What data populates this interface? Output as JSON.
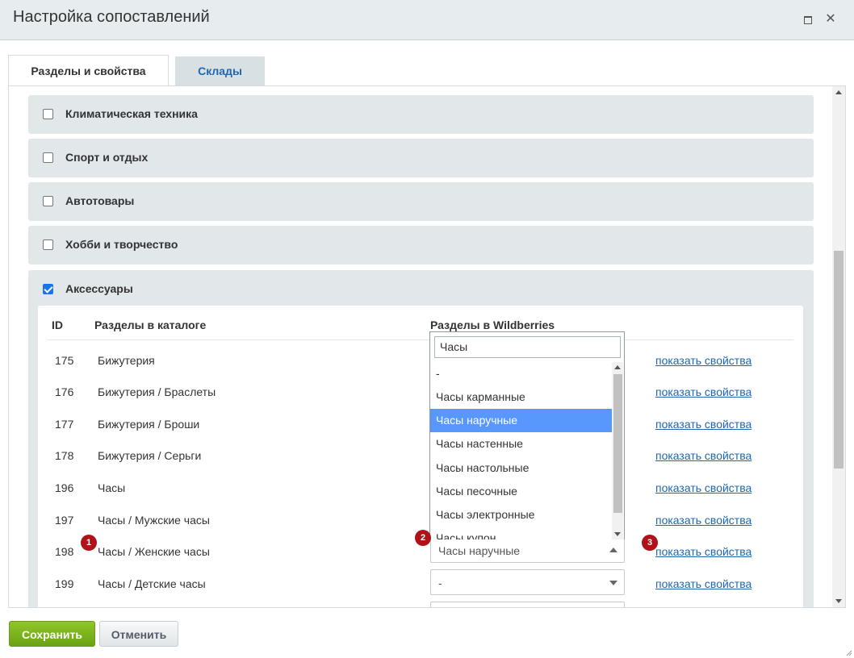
{
  "window": {
    "title": "Настройка сопоставлений"
  },
  "tabs": [
    {
      "label": "Разделы и свойства",
      "active": true
    },
    {
      "label": "Склады",
      "active": false
    }
  ],
  "categories": [
    {
      "label": "Климатическая техника",
      "checked": false
    },
    {
      "label": "Спорт и отдых",
      "checked": false
    },
    {
      "label": "Автотовары",
      "checked": false
    },
    {
      "label": "Хобби и творчество",
      "checked": false
    }
  ],
  "open_category": {
    "label": "Аксессуары",
    "checked": true
  },
  "table": {
    "headers": {
      "id": "ID",
      "catalog": "Разделы в каталоге",
      "wb": "Разделы в Wildberries"
    },
    "rows": [
      {
        "id": "175",
        "name": "Бижутерия",
        "link": "показать свойства"
      },
      {
        "id": "176",
        "name": "Бижутерия / Браслеты",
        "link": "показать свойства"
      },
      {
        "id": "177",
        "name": "Бижутерия / Броши",
        "link": "показать свойства"
      },
      {
        "id": "178",
        "name": "Бижутерия / Серьги",
        "link": "показать свойства"
      },
      {
        "id": "196",
        "name": "Часы",
        "link": "показать свойства"
      },
      {
        "id": "197",
        "name": "Часы / Мужские часы",
        "link": "показать свойства"
      },
      {
        "id": "198",
        "name": "Часы / Женские часы",
        "link": "показать свойства",
        "select": "Часы наручные"
      },
      {
        "id": "199",
        "name": "Часы / Детские часы",
        "link": "показать свойства",
        "select": "-"
      }
    ]
  },
  "dropdown": {
    "search_value": "Часы",
    "options": [
      "-",
      "Часы карманные",
      "Часы наручные",
      "Часы настенные",
      "Часы настольные",
      "Часы песочные",
      "Часы электронные",
      "Часы купон"
    ],
    "selected": "Часы наручные"
  },
  "badges": [
    "1",
    "2",
    "3"
  ],
  "badge_color": "#b0121a",
  "footer": {
    "save": "Сохранить",
    "cancel": "Отменить"
  }
}
